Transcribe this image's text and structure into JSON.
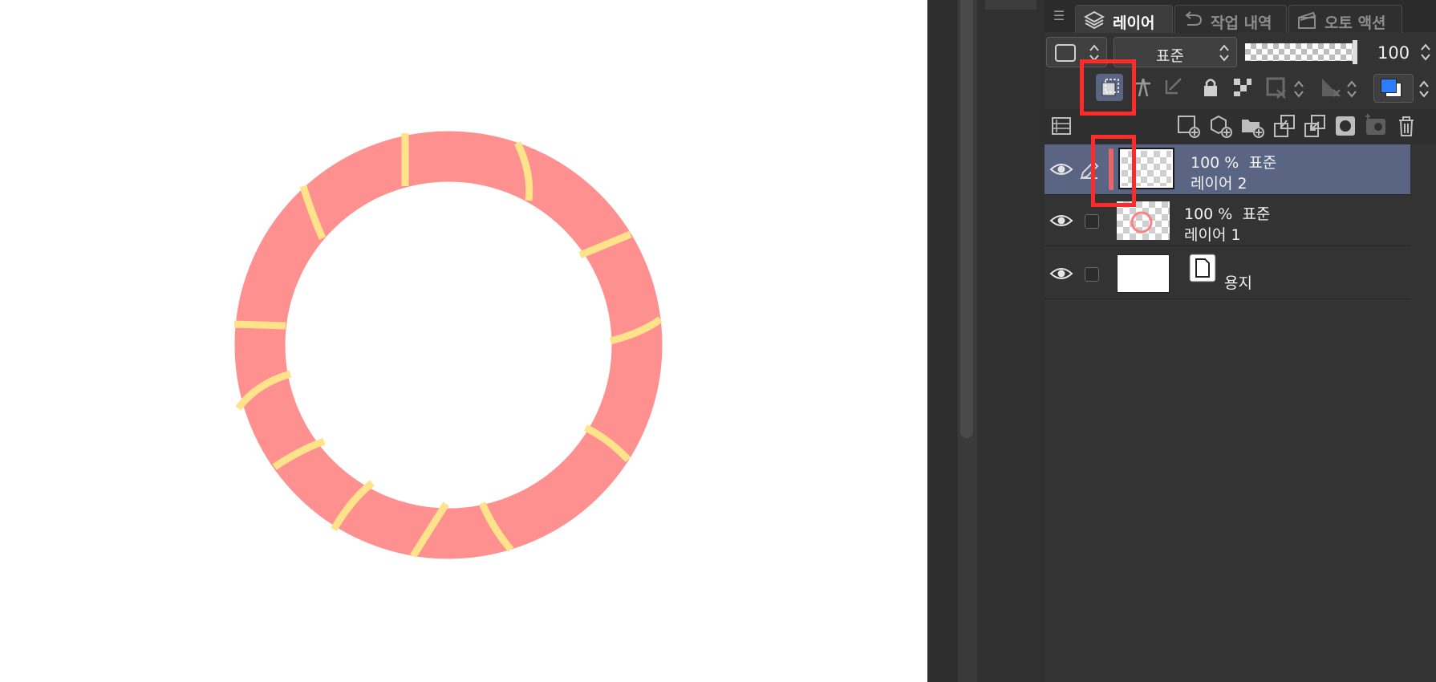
{
  "canvas": {
    "background": "#ffffff",
    "ring_color": "#ff9090",
    "stripe_color": "#ffe38a"
  },
  "panel": {
    "menu_icon": "hamburger-menu-icon",
    "tabs": [
      {
        "label": "레이어",
        "icon": "layers-icon",
        "active": true
      },
      {
        "label": "작업 내역",
        "icon": "history-icon",
        "active": false
      },
      {
        "label": "오토 액션",
        "icon": "clapperboard-icon",
        "active": false
      }
    ],
    "blend_mode": "표준",
    "opacity_value": "100"
  },
  "layers": [
    {
      "opacity": "100 %",
      "blend": "표준",
      "name": "레이어 2",
      "selected": true,
      "visible": true
    },
    {
      "opacity": "100 %",
      "blend": "표준",
      "name": "레이어 1",
      "selected": false,
      "visible": true
    },
    {
      "name": "용지",
      "selected": false,
      "visible": true
    }
  ],
  "highlight_color": "#ff2b2b",
  "selected_row_color": "#5a6584"
}
